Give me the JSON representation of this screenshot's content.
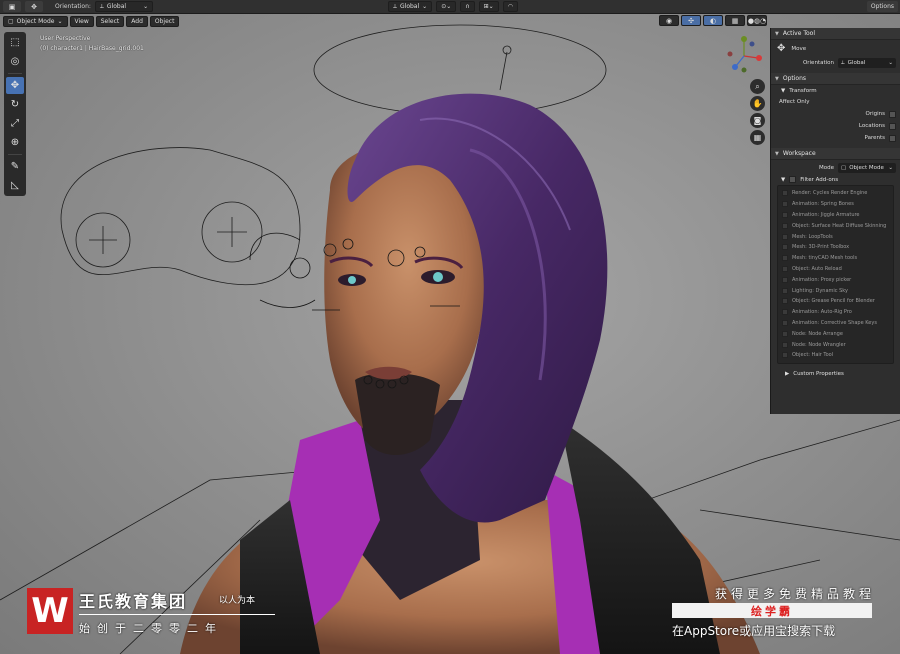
{
  "header": {
    "editor_icon": "3D",
    "orientation_label": "Orientation:",
    "orientation_value": "Global",
    "pivot_value": "Global",
    "options_label": "Options"
  },
  "menu": {
    "mode": "Object Mode",
    "view": "View",
    "select": "Select",
    "add": "Add",
    "object": "Object"
  },
  "viewport": {
    "perspective": "User Perspective",
    "active_object": "(0) character1 | HairBase_grid.001"
  },
  "tools": [
    {
      "name": "select-box-tool",
      "glyph": "⬚"
    },
    {
      "name": "cursor-tool",
      "glyph": "◎"
    },
    {
      "name": "move-tool",
      "glyph": "✥"
    },
    {
      "name": "rotate-tool",
      "glyph": "↻"
    },
    {
      "name": "scale-tool",
      "glyph": "⤢"
    },
    {
      "name": "transform-tool",
      "glyph": "⊕"
    },
    {
      "name": "annotate-tool",
      "glyph": "✎"
    },
    {
      "name": "measure-tool",
      "glyph": "📐"
    }
  ],
  "panel": {
    "active_tool": {
      "title": "Active Tool",
      "tool_name": "Move",
      "orientation_label": "Orientation",
      "orientation_value": "Global"
    },
    "options": {
      "title": "Options",
      "transform_title": "Transform",
      "affect_only": "Affect Only",
      "origins": "Origins",
      "locations": "Locations",
      "parents": "Parents"
    },
    "workspace": {
      "title": "Workspace",
      "mode_label": "Mode",
      "mode_value": "Object Mode",
      "filter_addons": "Filter Add-ons",
      "addons": [
        "Render: Cycles Render Engine",
        "Animation: Spring Bones",
        "Animation: Jiggle Armature",
        "Object: Surface Heat Diffuse Skinning",
        "Mesh: LoopTools",
        "Mesh: 3D-Print Toolbox",
        "Mesh: tinyCAD Mesh tools",
        "Object: Auto Reload",
        "Animation: Proxy picker",
        "Lighting: Dynamic Sky",
        "Object: Grease Pencil for Blender",
        "Animation: Auto-Rig Pro",
        "Animation: Corrective Shape Keys",
        "Node: Node Arrange",
        "Node: Node Wrangler",
        "Object: Hair Tool"
      ],
      "custom_properties": "Custom Properties"
    }
  },
  "watermark": {
    "logo": "W",
    "name": "王氏教育集团",
    "motto": "以人为本",
    "since": "始创于二零零二年",
    "promo_top": "获得更多免费精品教程",
    "promo_brand": "绘学霸",
    "promo_bottom": "在AppStore或应用宝搜索下载"
  },
  "colors": {
    "accent": "#4772b3",
    "hair": "#4a2b62",
    "logo_red": "#c82323"
  }
}
